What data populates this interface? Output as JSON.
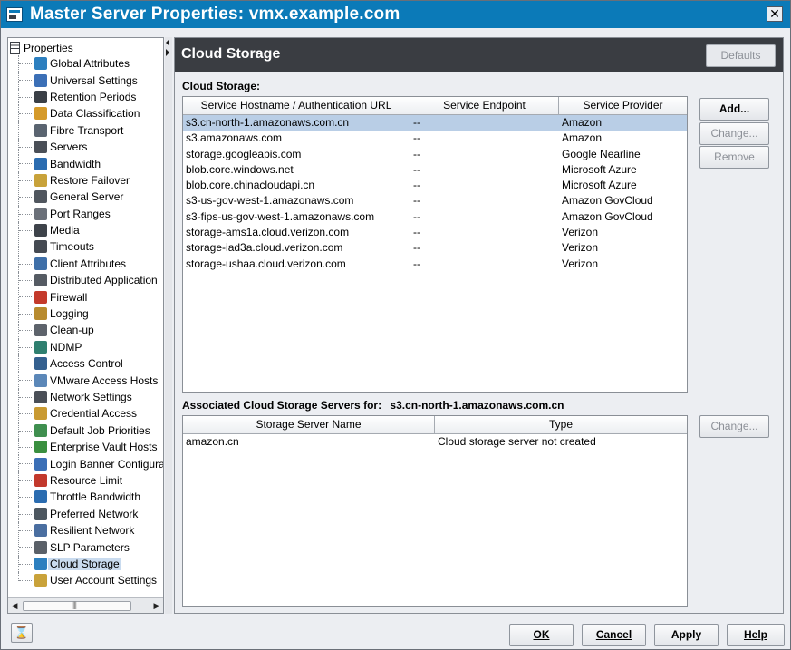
{
  "window": {
    "title": "Master Server Properties: vmx.example.com",
    "close_glyph": "✕"
  },
  "tree": {
    "root_label": "Properties",
    "items": [
      {
        "label": "Global Attributes",
        "icon": "globe-icon",
        "color": "#2c7fbf"
      },
      {
        "label": "Universal Settings",
        "icon": "universal-settings-icon",
        "color": "#3b6fb6"
      },
      {
        "label": "Retention Periods",
        "icon": "retention-icon",
        "color": "#3a3f46"
      },
      {
        "label": "Data Classification",
        "icon": "data-classification-icon",
        "color": "#d59a2a"
      },
      {
        "label": "Fibre Transport",
        "icon": "fibre-transport-icon",
        "color": "#5a6470"
      },
      {
        "label": "Servers",
        "icon": "server-icon",
        "color": "#4a4f57"
      },
      {
        "label": "Bandwidth",
        "icon": "bandwidth-icon",
        "color": "#2b6cb0"
      },
      {
        "label": "Restore Failover",
        "icon": "restore-failover-icon",
        "color": "#c8a23a"
      },
      {
        "label": "General Server",
        "icon": "general-server-icon",
        "color": "#50565e"
      },
      {
        "label": "Port Ranges",
        "icon": "port-ranges-icon",
        "color": "#6b7079"
      },
      {
        "label": "Media",
        "icon": "media-icon",
        "color": "#3e434a"
      },
      {
        "label": "Timeouts",
        "icon": "timeouts-icon",
        "color": "#454a52"
      },
      {
        "label": "Client Attributes",
        "icon": "client-attributes-icon",
        "color": "#3f6fa8"
      },
      {
        "label": "Distributed Application",
        "icon": "distributed-app-icon",
        "color": "#555b63"
      },
      {
        "label": "Firewall",
        "icon": "firewall-icon",
        "color": "#c43a2b"
      },
      {
        "label": "Logging",
        "icon": "logging-icon",
        "color": "#b88b2e"
      },
      {
        "label": "Clean-up",
        "icon": "cleanup-icon",
        "color": "#5d636b"
      },
      {
        "label": "NDMP",
        "icon": "ndmp-icon",
        "color": "#2f7f6f"
      },
      {
        "label": "Access Control",
        "icon": "access-control-icon",
        "color": "#34608f"
      },
      {
        "label": "VMware Access Hosts",
        "icon": "vmware-hosts-icon",
        "color": "#5b87b8"
      },
      {
        "label": "Network Settings",
        "icon": "network-settings-icon",
        "color": "#4a4f57"
      },
      {
        "label": "Credential Access",
        "icon": "credential-icon",
        "color": "#c99a32"
      },
      {
        "label": "Default Job Priorities",
        "icon": "job-priorities-icon",
        "color": "#3f8f4f"
      },
      {
        "label": "Enterprise Vault Hosts",
        "icon": "vault-hosts-icon",
        "color": "#3a8f3f"
      },
      {
        "label": "Login Banner Configuration",
        "icon": "login-banner-icon",
        "color": "#3b6fb6"
      },
      {
        "label": "Resource Limit",
        "icon": "resource-limit-icon",
        "color": "#c2382c"
      },
      {
        "label": "Throttle Bandwidth",
        "icon": "throttle-icon",
        "color": "#2b6cb0"
      },
      {
        "label": "Preferred Network",
        "icon": "preferred-network-icon",
        "color": "#4d5760"
      },
      {
        "label": "Resilient Network",
        "icon": "resilient-network-icon",
        "color": "#4a6ea0"
      },
      {
        "label": "SLP Parameters",
        "icon": "slp-icon",
        "color": "#5a6068"
      },
      {
        "label": "Cloud Storage",
        "icon": "cloud-storage-icon",
        "color": "#2c7fbf",
        "selected": true
      },
      {
        "label": "User Account Settings",
        "icon": "user-account-icon",
        "color": "#c9a23a"
      }
    ]
  },
  "content": {
    "header_title": "Cloud Storage",
    "defaults_label": "Defaults",
    "cloud_storage_label": "Cloud Storage:",
    "cloud_table": {
      "columns": [
        "Service Hostname / Authentication URL",
        "Service Endpoint",
        "Service Provider"
      ],
      "rows": [
        [
          "s3.cn-north-1.amazonaws.com.cn",
          "--",
          "Amazon"
        ],
        [
          "s3.amazonaws.com",
          "--",
          "Amazon"
        ],
        [
          "storage.googleapis.com",
          "--",
          "Google Nearline"
        ],
        [
          "blob.core.windows.net",
          "--",
          "Microsoft Azure"
        ],
        [
          "blob.core.chinacloudapi.cn",
          "--",
          "Microsoft Azure"
        ],
        [
          "s3-us-gov-west-1.amazonaws.com",
          "--",
          "Amazon GovCloud"
        ],
        [
          "s3-fips-us-gov-west-1.amazonaws.com",
          "--",
          "Amazon GovCloud"
        ],
        [
          "storage-ams1a.cloud.verizon.com",
          "--",
          "Verizon"
        ],
        [
          "storage-iad3a.cloud.verizon.com",
          "--",
          "Verizon"
        ],
        [
          "storage-ushaa.cloud.verizon.com",
          "--",
          "Verizon"
        ]
      ],
      "selected_row": 0
    },
    "buttons": {
      "add": "Add...",
      "change": "Change...",
      "remove": "Remove",
      "change2": "Change..."
    },
    "associated_label": "Associated Cloud Storage Servers for:",
    "associated_host": "s3.cn-north-1.amazonaws.com.cn",
    "server_table": {
      "columns": [
        "Storage Server Name",
        "Type"
      ],
      "rows": [
        [
          "amazon.cn",
          "Cloud storage server not created"
        ]
      ]
    }
  },
  "footer": {
    "ok": "OK",
    "cancel": "Cancel",
    "apply": "Apply",
    "help": "Help"
  },
  "colors": {
    "titlebar": "#0b7ab8",
    "header": "#3a3d42",
    "selection": "#b9cee6"
  }
}
